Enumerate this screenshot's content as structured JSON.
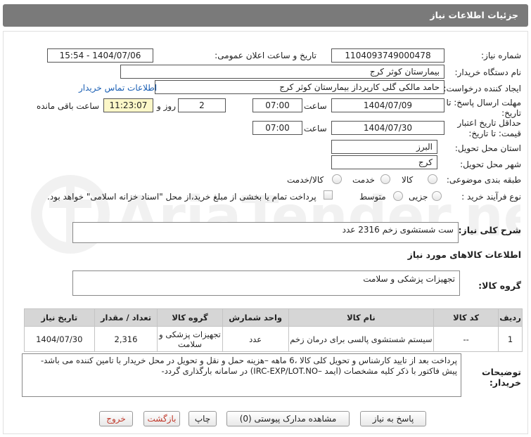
{
  "header": {
    "title": "جزئیات اطلاعات نیاز"
  },
  "fields": {
    "need_number_label": "شماره نیاز:",
    "need_number": "1104093749000478",
    "announce_label": "تاریخ و ساعت اعلان عمومی:",
    "announce_value": "1404/07/06 - 15:54",
    "buyer_label": "نام دستگاه خریدار:",
    "buyer_value": "بیمارستان کوثر کرج",
    "creator_label": "ایجاد کننده درخواست:",
    "creator_value": "حامد مالکی گلی کارپرداز بیمارستان کوثر کرج",
    "contact_link": "اطلاعات تماس خریدار",
    "deadline_label_1": "مهلت ارسال پاسخ: تا",
    "deadline_label_2": "تاریخ:",
    "deadline_date": "1404/07/09",
    "time_label": "ساعت",
    "deadline_time": "07:00",
    "days_value": "2",
    "days_label": "روز و",
    "remaining_time": "11:23:07",
    "remaining_label": "ساعت باقی مانده",
    "validity_label_1": "حداقل تاریخ اعتبار",
    "validity_label_2": "قیمت: تا تاریخ:",
    "validity_date": "1404/07/30",
    "validity_time": "07:00",
    "province_label": "استان محل تحویل:",
    "province_value": "البرز",
    "city_label": "شهر محل تحویل:",
    "city_value": "کرج",
    "category_label": "طبقه بندی موضوعی:",
    "cat_goods": "کالا",
    "cat_service": "خدمت",
    "cat_goods_service": "کالا/خدمت",
    "purchase_label": "نوع فرآیند خرید :",
    "purchase_partial": "جزیی",
    "purchase_medium": "متوسط",
    "payment_note": "پرداخت تمام یا بخشی از مبلغ خرید،از محل \"اسناد خزانه اسلامی\" خواهد بود."
  },
  "description": {
    "label": "شرح کلی نیاز:",
    "value": "ست شستشوی زخم 2316 عدد"
  },
  "goods_info": {
    "title": "اطلاعات کالاهای مورد نیاز",
    "group_label": "گروه کالا:",
    "group_value": "تجهیزات پزشکی و سلامت"
  },
  "table": {
    "headers": [
      "ردیف",
      "کد کالا",
      "نام کالا",
      "واحد شمارش",
      "گروه کالا",
      "تعداد / مقدار",
      "تاریخ نیاز"
    ],
    "rows": [
      {
        "row": "1",
        "code": "--",
        "name": "سیستم شستشوی پالسی برای درمان زخم",
        "unit": "عدد",
        "group_line1": "تجهیزات پزشکی و",
        "group_line2": "سلامت",
        "qty": "2,316",
        "date": "1404/07/30"
      }
    ]
  },
  "buyer_notes": {
    "label_1": "توضیحات",
    "label_2": "خریدار:",
    "line1": "پرداخت بعد از تایید کارشناس و تحویل کلی کالا ،6 ماهه –هزینه حمل و نقل و تحویل در محل خریدار با تامین کننده می باشد-",
    "line2": "پیش فاکتور با ذکر کلیه مشخصات (ایمد –IRC-EXP/LOT.NO) در سامانه بارگذاری گردد-"
  },
  "buttons": {
    "reply": "پاسخ به نیاز",
    "attachments": "مشاهده مدارک پیوستی (0)",
    "print": "چاپ",
    "back": "بازگشت",
    "exit": "خروج"
  },
  "watermark": {
    "text": "AriaTender.net"
  }
}
